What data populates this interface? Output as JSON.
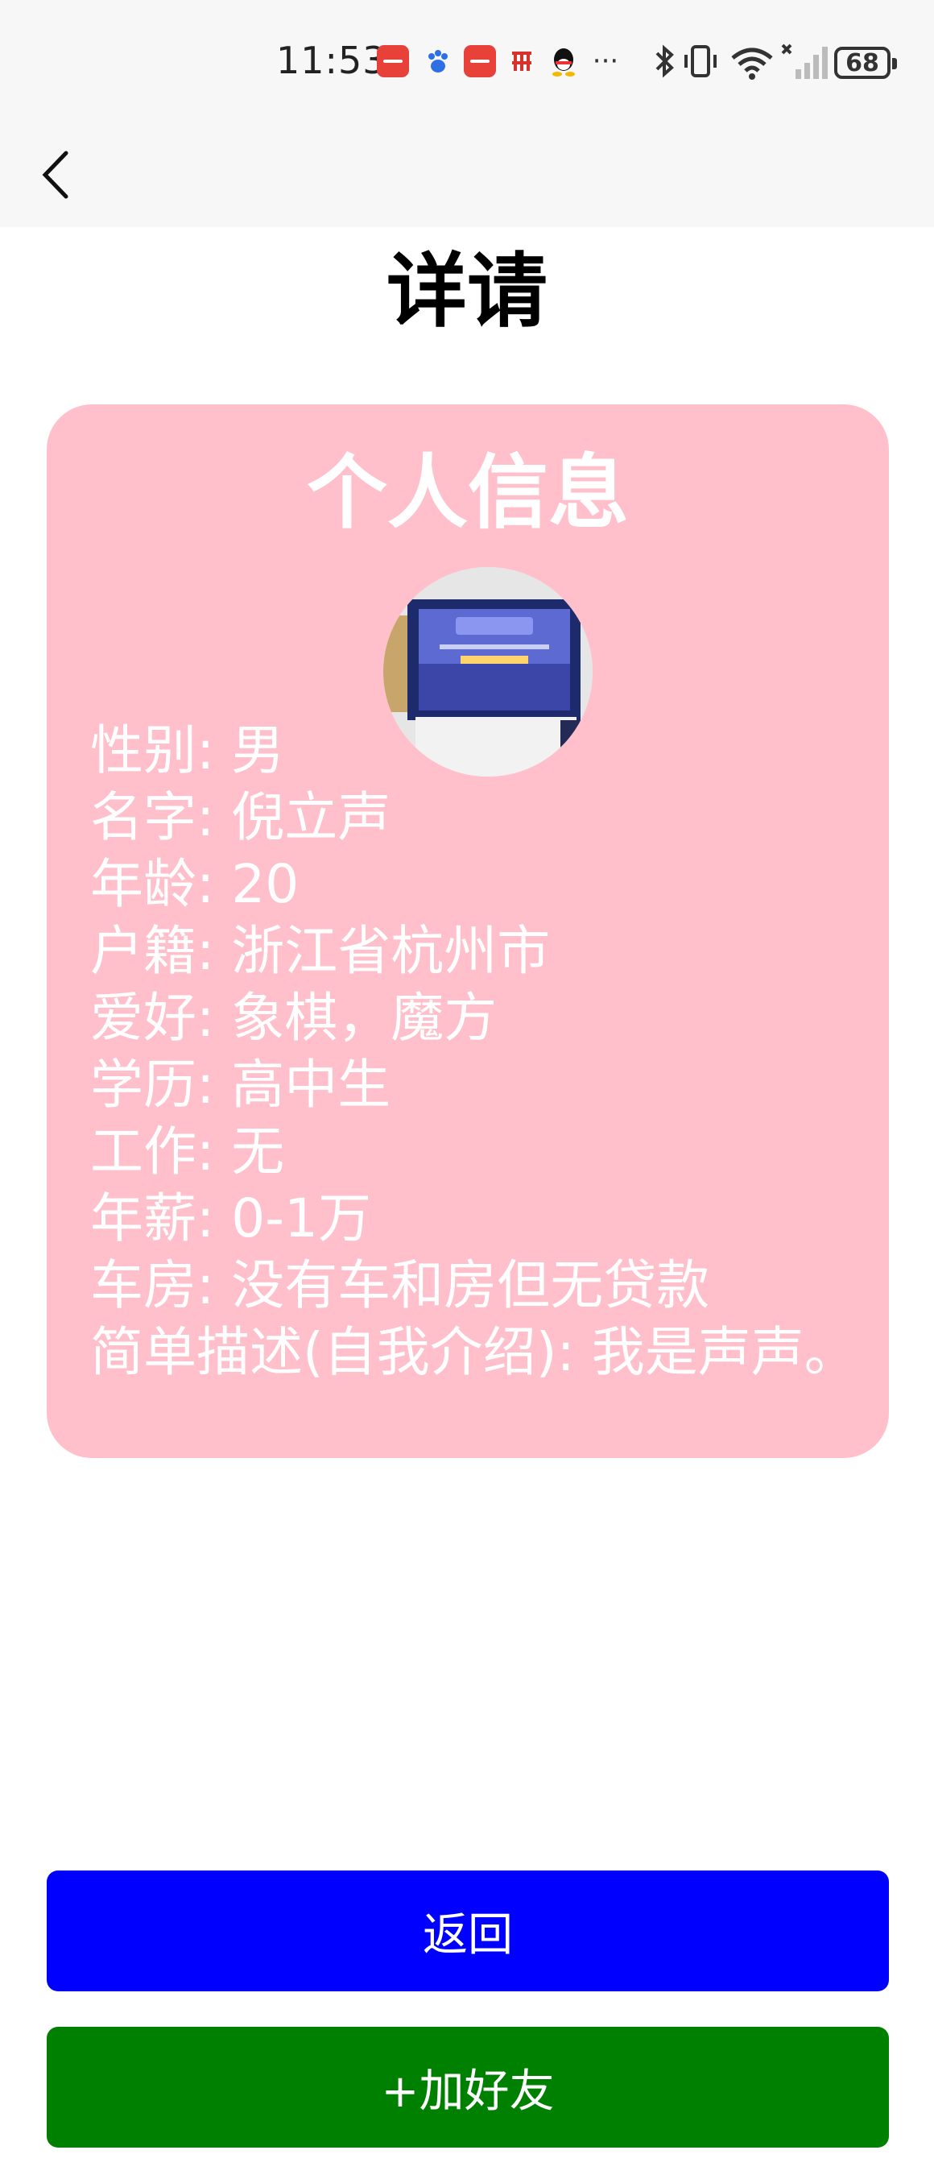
{
  "status_bar": {
    "time": "11:53",
    "battery": "68",
    "notification_icons": [
      "huawei-appgallery-icon",
      "baidu-icon",
      "huawei-appgallery-icon",
      "postal-icon",
      "qq-icon",
      "more-dots-icon"
    ],
    "system_icons": [
      "bluetooth-icon",
      "vibrate-icon",
      "wifi-icon",
      "signal-icon"
    ],
    "more_label": "···"
  },
  "page": {
    "title": "详请"
  },
  "card": {
    "title": "个人信息",
    "color": "#ffc0cb",
    "lines": [
      "性别: 男",
      "名字: 倪立声",
      "年龄: 20",
      "户籍: 浙江省杭州市",
      "爱好: 象棋，魔方",
      "学历: 高中生",
      "工作: 无",
      "年薪: 0-1万",
      "车房: 没有车和房但无贷款",
      "简单描述(自我介绍): 我是声声。"
    ]
  },
  "buttons": {
    "back_label": "返回",
    "back_color": "#0000ff",
    "add_friend_label": "+加好友",
    "add_friend_color": "#008000"
  }
}
